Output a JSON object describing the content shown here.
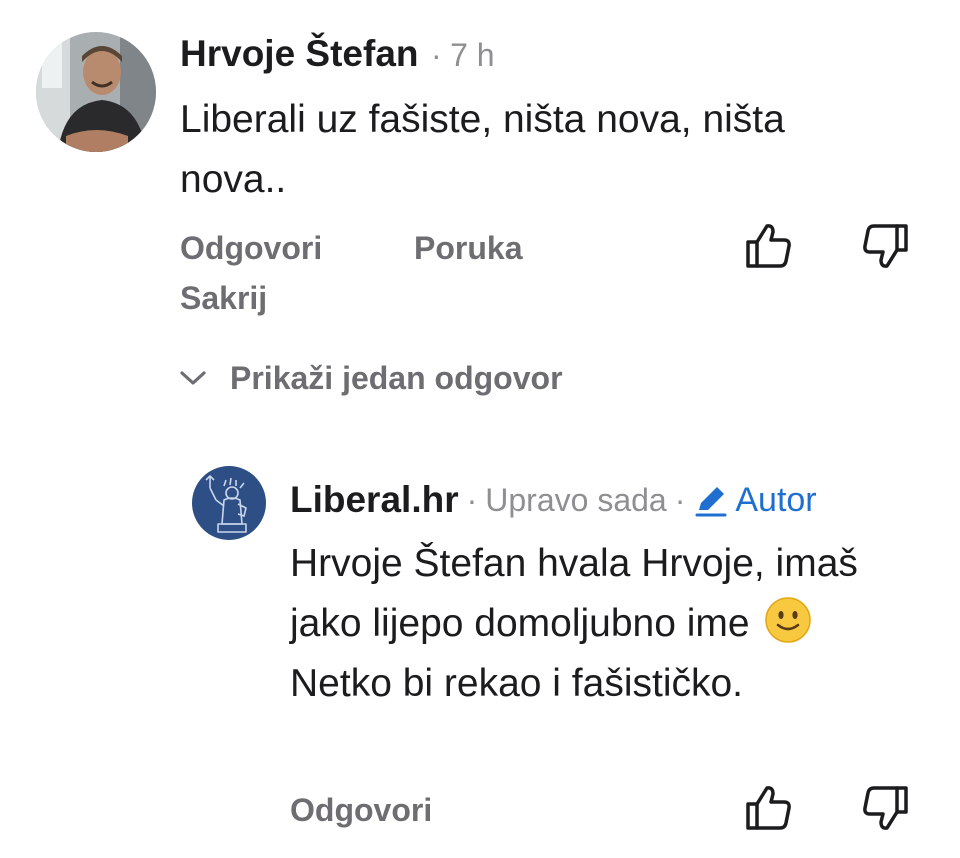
{
  "comment": {
    "author": "Hrvoje Štefan",
    "separator": "·",
    "time": "7 h",
    "text": "Liberali uz fašiste, ništa nova, ništa nova..",
    "actions": {
      "reply": "Odgovori",
      "message": "Poruka",
      "hide": "Sakrij"
    },
    "icons": {
      "like": "thumbs-up-icon",
      "dislike": "thumbs-down-icon"
    },
    "replies_toggle": "Prikaži jedan odgovor"
  },
  "reply": {
    "author": "Liberal.hr",
    "separator": "·",
    "time": "Upravo sada",
    "separator2": "·",
    "author_badge": "Autor",
    "text_part1": "Hrvoje Štefan hvala Hrvoje, imaš jako lijepo domoljubno ime",
    "emoji": "slightly-smiling-face-emoji",
    "text_part2": "Netko bi rekao i fašističko.",
    "actions": {
      "reply": "Odgovori"
    }
  },
  "colors": {
    "text": "#1c1c1e",
    "muted": "#6d6d72",
    "meta": "#8e8e93",
    "accent": "#1f6fd1",
    "logo_bg": "#2e4f86"
  }
}
